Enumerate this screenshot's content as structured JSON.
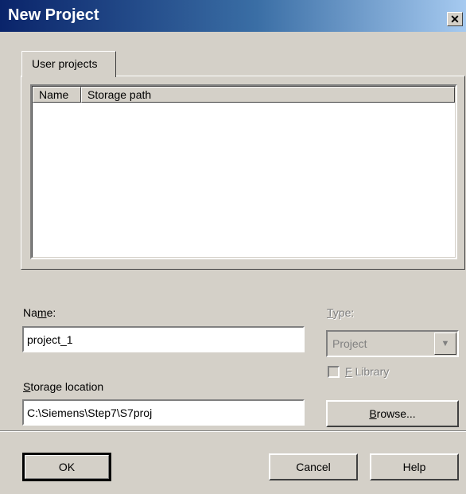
{
  "window": {
    "title": "New Project",
    "close_glyph": "✕"
  },
  "tabs": [
    {
      "label": "User projects"
    }
  ],
  "project_list": {
    "columns": [
      {
        "label": "Name"
      },
      {
        "label": "Storage path"
      }
    ],
    "rows": []
  },
  "form": {
    "name_label_prefix": "Na",
    "name_label_accel": "m",
    "name_label_suffix": "e:",
    "name_value": "project_1",
    "type_label_accel": "T",
    "type_label_suffix": "ype:",
    "type_value": "Project",
    "f_library_accel": "F",
    "f_library_suffix": " Library",
    "storage_label_accel": "S",
    "storage_label_suffix": "torage location",
    "storage_value": "C:\\Siemens\\Step7\\S7proj",
    "browse_accel": "B",
    "browse_suffix": "rowse..."
  },
  "buttons": {
    "ok": "OK",
    "cancel": "Cancel",
    "help": "Help"
  },
  "colors": {
    "face": "#d4d0c8",
    "title_start": "#0a246a",
    "title_end": "#a6caf0",
    "disabled_text": "#808080"
  }
}
